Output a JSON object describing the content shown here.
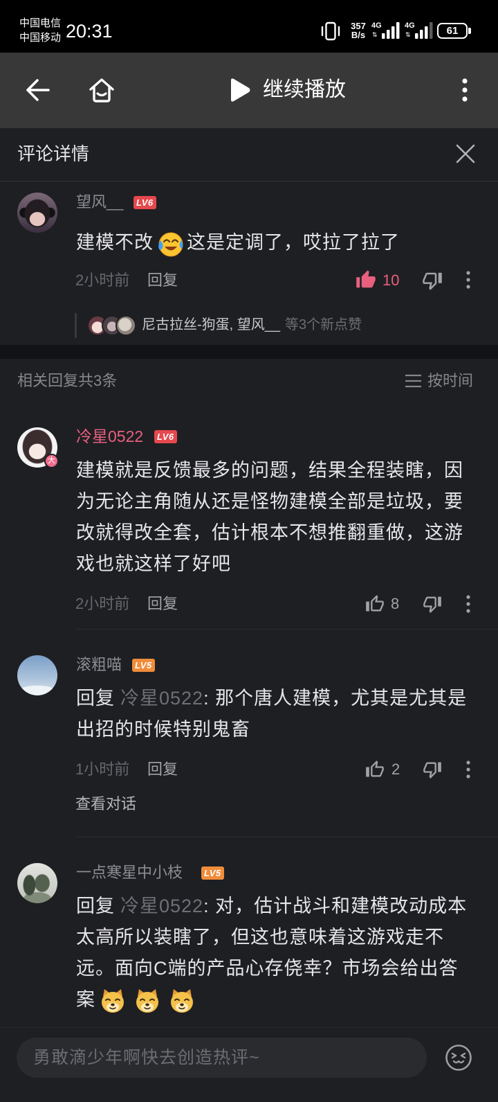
{
  "status_bar": {
    "carriers": [
      "中国电信",
      "中国移动"
    ],
    "time": "20:31",
    "vibrate_icon": "vibrate-icon",
    "net_speed": {
      "value": "357",
      "unit": "B/s"
    },
    "signals": [
      {
        "type": "4G",
        "bars": 4
      },
      {
        "type": "4G",
        "bars": 3
      }
    ],
    "battery": "61"
  },
  "nav": {
    "back_icon": "back-arrow-icon",
    "home_icon": "home-icon",
    "play_icon": "play-icon",
    "continue_label": "继续播放",
    "more_icon": "more-vertical-icon"
  },
  "panel": {
    "title": "评论详情",
    "close_icon": "close-icon"
  },
  "root_comment": {
    "username": "望风__",
    "level": "LV6",
    "text_before": "建模不改",
    "emoji": "laugh-cry-emoji",
    "text_after": "这是定调了，哎拉了拉了",
    "time": "2小时前",
    "reply_label": "回复",
    "like_count": "10",
    "liked": true,
    "likers": {
      "names": "尼古拉丝-狗蛋, 望风__",
      "suffix": "等3个新点赞"
    }
  },
  "replies_header": {
    "count_label": "相关回复共3条",
    "sort_icon": "sort-list-icon",
    "sort_label": "按时间"
  },
  "replies": [
    {
      "username": "冷星0522",
      "level": "LV6",
      "vip_badge": "大",
      "lines": [
        "建模就是反馈最多的问题，结果全程装瞎，因",
        "为无论主角随从还是怪物建模全部是垃圾，要",
        "改就得改全套，估计根本不想推翻重做，这游",
        "戏也就这样了好吧"
      ],
      "time": "2小时前",
      "reply_label": "回复",
      "like_count": "8"
    },
    {
      "username": "滚粗喵",
      "level": "LV5",
      "reply_to": {
        "prefix": "回复",
        "mention": "冷星0522"
      },
      "lines": [
        ": 那个唐人建模，尤其是尤其是",
        "出招的时候特别鬼畜"
      ],
      "time": "1小时前",
      "reply_label": "回复",
      "like_count": "2",
      "view_thread_label": "查看对话"
    },
    {
      "username": "一点寒星中小枝",
      "level": "LV5",
      "reply_to": {
        "prefix": "回复",
        "mention": "冷星0522"
      },
      "lines": [
        ": 对，估计战斗和建模改动成本",
        "太高所以装瞎了，但这也意味着这游戏走不",
        "远。面向C端的产品心存侥幸？市场会给出答",
        "案"
      ],
      "emojis": [
        "doge-emoji",
        "doge-emoji",
        "doge-emoji"
      ]
    }
  ],
  "composer": {
    "placeholder": "勇敢滴少年啊快去创造热评~",
    "emoji_icon": "emoji-face-icon"
  },
  "colors": {
    "background": "#1e1f23",
    "navbar": "#383838",
    "accent_pink": "#e8607e",
    "level6_badge": "#e5484d",
    "level5_badge": "#f08c3a"
  }
}
